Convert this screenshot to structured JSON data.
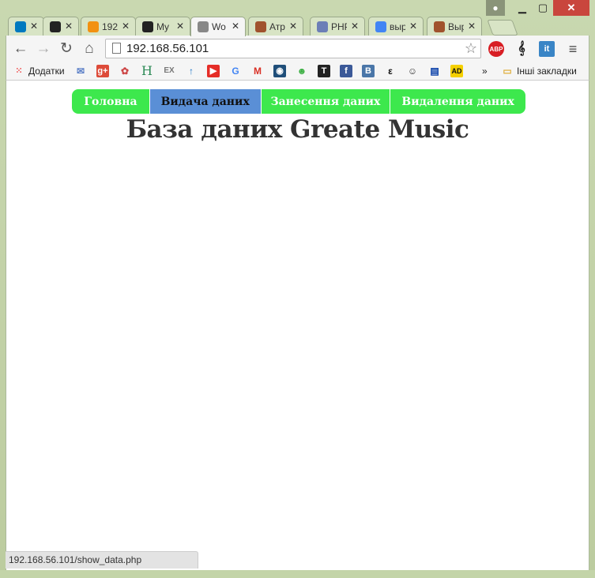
{
  "browser": {
    "tabs": [
      {
        "label": "",
        "icon": "trello-icon",
        "color": "#0079bf"
      },
      {
        "label": "",
        "icon": "github-icon",
        "color": "#222222"
      },
      {
        "label": "192",
        "icon": "phpmyadmin-icon",
        "color": "#f29111"
      },
      {
        "label": "My",
        "icon": "github-icon",
        "color": "#222222"
      },
      {
        "label": "Wo",
        "icon": "page-icon",
        "color": "#888888"
      },
      {
        "label": "Атр",
        "icon": "blocks-icon",
        "color": "#a0522d"
      },
      {
        "label": "PHP",
        "icon": "php-icon",
        "color": "#6c7eb7"
      },
      {
        "label": "выр",
        "icon": "google-icon",
        "color": "#4285f4"
      },
      {
        "label": "Выр",
        "icon": "blocks-icon",
        "color": "#a0522d"
      }
    ],
    "tab_close_glyph": "✕",
    "active_tab_index": 4,
    "url": "192.168.56.101",
    "status_text": "192.168.56.101/show_data.php",
    "bookmarks": {
      "apps_label": "Додатки",
      "items": [
        {
          "icon": "mail-icon",
          "text": "✉",
          "color": "#5b7fc7"
        },
        {
          "icon": "google-plus-icon",
          "text": "g+",
          "color": "#dd4b39"
        },
        {
          "icon": "color-icon",
          "text": "✿",
          "color": "#c44"
        },
        {
          "icon": "h-icon",
          "text": "H",
          "color": "#2e8b57"
        },
        {
          "icon": "ex-icon",
          "text": "EX",
          "color": "#777777"
        },
        {
          "icon": "arrow-up-icon",
          "text": "↑",
          "color": "#1a73c8"
        },
        {
          "icon": "youtube-icon",
          "text": "▶",
          "color": "#e52d27"
        },
        {
          "icon": "google-icon",
          "text": "G",
          "color": "#4285f4"
        },
        {
          "icon": "gmail-icon",
          "text": "M",
          "color": "#d93025"
        },
        {
          "icon": "camera-icon",
          "text": "◉",
          "color": "#1f4e79"
        },
        {
          "icon": "frog-icon",
          "text": "☻",
          "color": "#3cb043"
        },
        {
          "icon": "t-icon",
          "text": "T",
          "color": "#222222"
        },
        {
          "icon": "facebook-icon",
          "text": "f",
          "color": "#3b5998"
        },
        {
          "icon": "vk-icon",
          "text": "B",
          "color": "#4a76a8"
        },
        {
          "icon": "epsilon-icon",
          "text": "ε",
          "color": "#111111"
        },
        {
          "icon": "face-icon",
          "text": "☺",
          "color": "#333333"
        },
        {
          "icon": "flag-icon",
          "text": "▤",
          "color": "#0039a6"
        },
        {
          "icon": "ad-icon",
          "text": "AD",
          "color": "#f5d000"
        }
      ],
      "more": "»",
      "other_label": "Інші закладки"
    },
    "extensions": [
      {
        "icon": "adblock-icon",
        "text": "ABP",
        "color": "#d81e24"
      },
      {
        "icon": "music-icon",
        "text": "𝄞",
        "color": "#222222"
      },
      {
        "icon": "it-icon",
        "text": "it",
        "color": "#3a85c6"
      }
    ]
  },
  "page": {
    "menu": [
      {
        "label": "Головна",
        "active": false
      },
      {
        "label": "Видача даних",
        "active": true
      },
      {
        "label": "Занесення даних",
        "active": false
      },
      {
        "label": "Видалення даних",
        "active": false
      }
    ],
    "heading": "База даних Greate Music",
    "colors": {
      "menu_bg": "#3de84d",
      "menu_active": "#5a8fd6",
      "heading": "#333333"
    }
  }
}
